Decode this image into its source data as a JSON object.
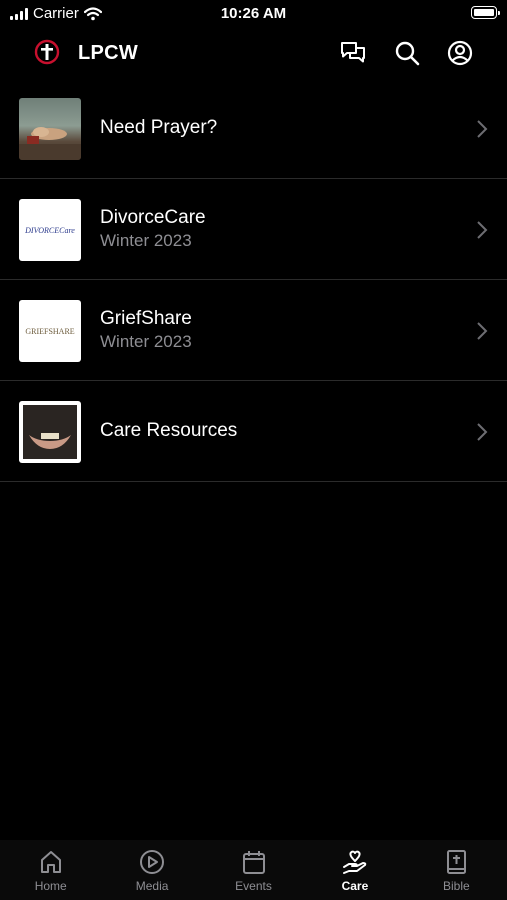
{
  "status_bar": {
    "carrier": "Carrier",
    "time": "10:26 AM"
  },
  "header": {
    "title": "LPCW",
    "logo_color": "#c8102e"
  },
  "list": [
    {
      "title": "Need Prayer?",
      "subtitle": "",
      "thumbnail": "praying-hands-photo"
    },
    {
      "title": "DivorceCare",
      "subtitle": "Winter 2023",
      "thumbnail": "divorcecare-logo",
      "logo_text": "DIVORCECare"
    },
    {
      "title": "GriefShare",
      "subtitle": "Winter 2023",
      "thumbnail": "griefshare-logo",
      "logo_text": "GRIEFSHARE"
    },
    {
      "title": "Care Resources",
      "subtitle": "",
      "thumbnail": "cupped-hands-photo"
    }
  ],
  "tabs": [
    {
      "label": "Home",
      "icon": "home-icon",
      "active": false
    },
    {
      "label": "Media",
      "icon": "play-icon",
      "active": false
    },
    {
      "label": "Events",
      "icon": "calendar-icon",
      "active": false
    },
    {
      "label": "Care",
      "icon": "care-hand-heart-icon",
      "active": true
    },
    {
      "label": "Bible",
      "icon": "bible-icon",
      "active": false
    }
  ],
  "colors": {
    "background": "#000000",
    "text": "#ffffff",
    "secondary_text": "#8e8e93",
    "divider": "#2b2b2b"
  }
}
